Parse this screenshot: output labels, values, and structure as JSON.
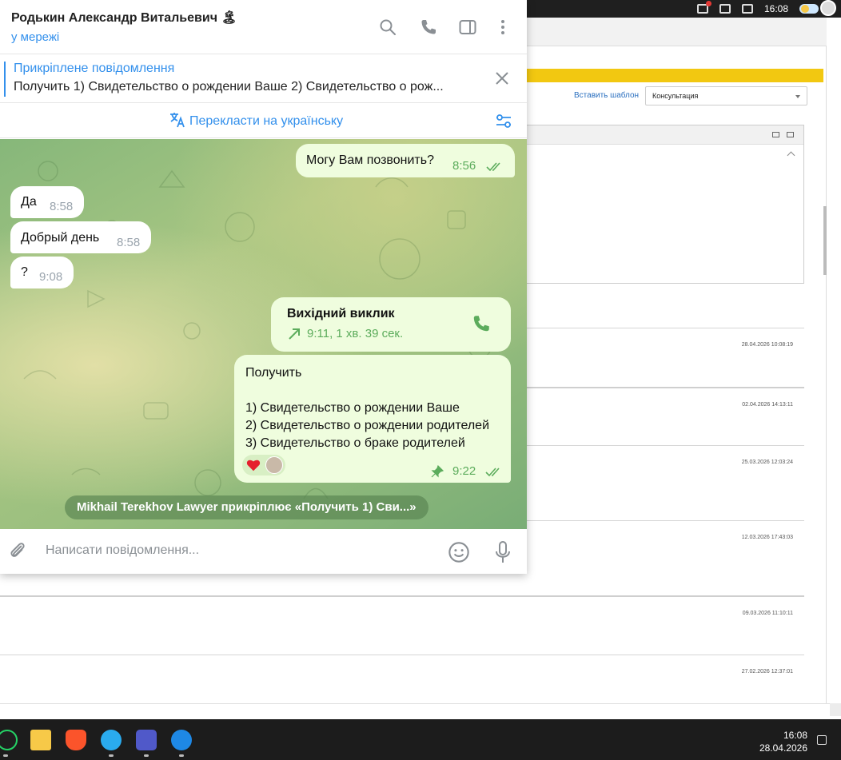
{
  "system": {
    "clock": "16:08",
    "date": "28.04.2026"
  },
  "background": {
    "insert_template_link": "Вставить шаблон",
    "select_value": "Консультация",
    "rows": [
      {
        "timestamp": "28.04.2026 10:08:19"
      },
      {
        "timestamp": "02.04.2026 14:13:11"
      },
      {
        "timestamp": "25.03.2026 12:03:24"
      },
      {
        "timestamp": "12.03.2026 17:43:03"
      },
      {
        "timestamp": "09.03.2026 11:10:11"
      },
      {
        "timestamp": "27.02.2026 12:37:01"
      }
    ]
  },
  "chat": {
    "contact_name": "Родькин Александр Витальевич 🏝",
    "status": "у мережі",
    "pinned": {
      "title": "Прикріплене повідомлення",
      "text": "Получить  1) Свидетельство о рождении Ваше 2) Свидетельство о рож..."
    },
    "translate_label": "Перекласти на українську",
    "messages": {
      "m1": {
        "text": "Могу Вам позвонить?",
        "time": "8:56"
      },
      "m2": {
        "text": "Да",
        "time": "8:58"
      },
      "m3": {
        "text": "Добрый день",
        "time": "8:58"
      },
      "m4": {
        "text": "?",
        "time": "9:08"
      },
      "call": {
        "title": "Вихідний виклик",
        "detail": "9:11, 1 хв. 39 сек."
      },
      "m5": {
        "line1": "Получить",
        "line2": "1) Свидетельство о рождении Ваше",
        "line3": "2) Свидетельство о рождении родителей",
        "line4": "3) Свидетельство о браке родителей",
        "time": "9:22"
      }
    },
    "service_message": "Mikhail Terekhov Lawyer прикріплює «Получить  1) Сви...»",
    "input_placeholder": "Написати повідомлення..."
  },
  "colors": {
    "accent": "#3390ec",
    "out_bubble": "#effdde",
    "out_time": "#5cac5c",
    "banner": "#f2c811"
  },
  "taskbar_apps": [
    "whatsapp-icon",
    "file-explorer-icon",
    "brave-icon",
    "telegram-icon",
    "teams-icon",
    "messenger-icon"
  ]
}
